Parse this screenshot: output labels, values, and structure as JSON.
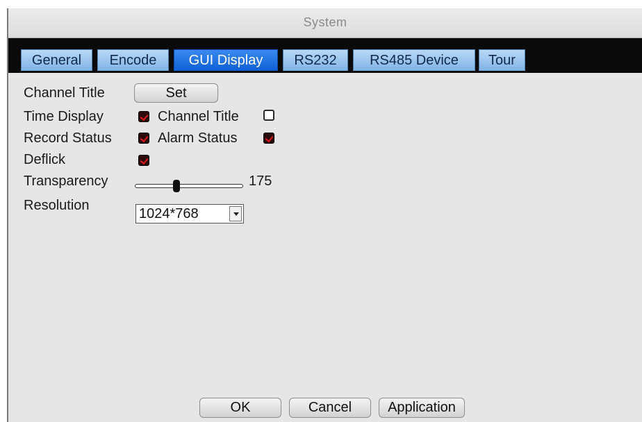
{
  "window": {
    "title": "System"
  },
  "tabs": [
    {
      "label": "General"
    },
    {
      "label": "Encode"
    },
    {
      "label": "GUI Display"
    },
    {
      "label": "RS232"
    },
    {
      "label": "RS485 Device"
    },
    {
      "label": "Tour"
    }
  ],
  "active_tab": "GUI Display",
  "form": {
    "channel_title_label": "Channel Title",
    "set_button": "Set",
    "time_display_label": "Time Display",
    "time_display_checked": true,
    "channel_title_check_label": "Channel Title",
    "channel_title_checked": false,
    "record_status_label": "Record Status",
    "record_status_checked": true,
    "alarm_status_label": "Alarm Status",
    "alarm_status_checked": true,
    "deflick_label": "Deflick",
    "deflick_checked": true,
    "transparency_label": "Transparency",
    "transparency_value": "175",
    "transparency_min": 128,
    "transparency_max": 255,
    "resolution_label": "Resolution",
    "resolution_value": "1024*768"
  },
  "footer": {
    "ok": "OK",
    "cancel": "Cancel",
    "application": "Application"
  },
  "colors": {
    "active_tab": "#1466e0",
    "inactive_tab": "#9cc6ee",
    "check_mark": "#e01818",
    "tab_bar": "#0a0a0a"
  }
}
